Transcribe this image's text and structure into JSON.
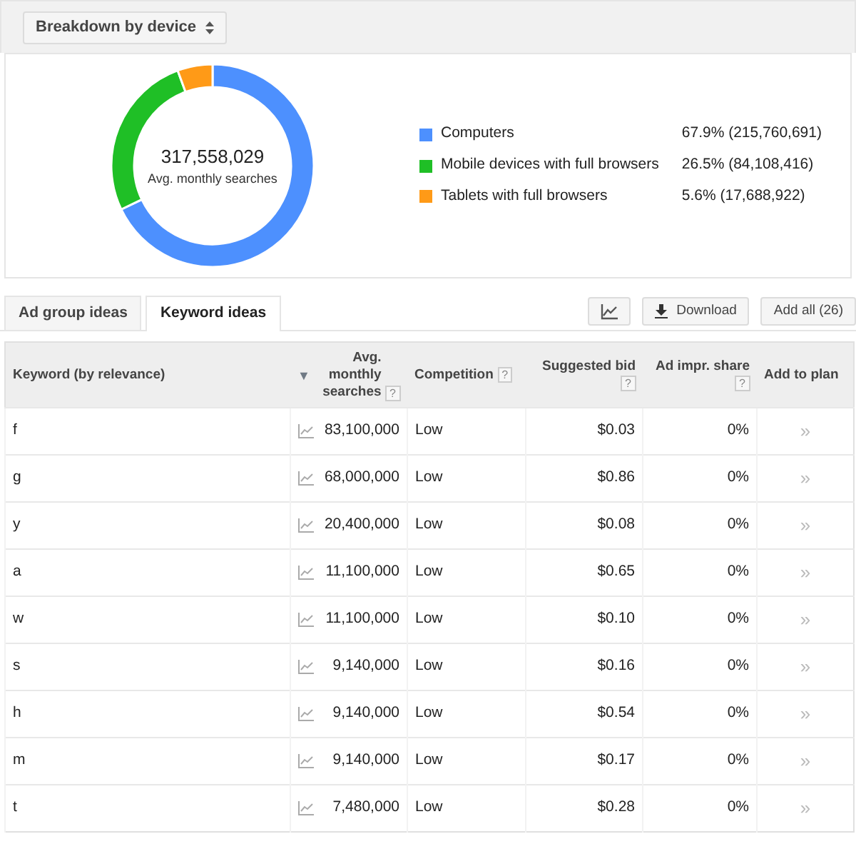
{
  "breakdown_button": {
    "label": "Breakdown by device"
  },
  "summary": {
    "total": "317,558,029",
    "chart_data": {
      "type": "donut",
      "categories": [
        "Computers",
        "Mobile devices with full browsers",
        "Tablets with full browsers"
      ],
      "series": [
        {
          "name": "Avg. monthly searches",
          "values": [
            67.9,
            26.5,
            5.6
          ]
        }
      ]
    },
    "legend": [
      {
        "value": "67.9% (215,760,691)",
        "color": "#4d90fe"
      },
      {
        "value": "26.5% (84,108,416)",
        "color": "#1fbf26"
      },
      {
        "value": "5.6% (17,688,922)",
        "color": "#ff9a17"
      }
    ]
  },
  "tabs": [
    {
      "label": "Ad group ideas",
      "selected": false
    },
    {
      "label": "Keyword ideas",
      "selected": true
    }
  ],
  "toolbar": {
    "download": "Download",
    "add_all": "Add all (26)"
  },
  "table": {
    "columns": [
      {
        "label": "Keyword (by relevance)"
      },
      {
        "label": "Avg. monthly searches",
        "help": true,
        "sorted": true
      },
      {
        "label": "Competition",
        "help": true
      },
      {
        "label": "Suggested bid",
        "help": true
      },
      {
        "label": "Ad impr. share",
        "help": true
      },
      {
        "label": "Add to plan"
      }
    ],
    "help_mark": "?",
    "sort_mark": "▼",
    "add_mark": "»",
    "rows": [
      {
        "keyword": "f",
        "searches": "83,100,000",
        "competition": "Low",
        "bid": "$0.03",
        "share": "0%"
      },
      {
        "keyword": "g",
        "searches": "68,000,000",
        "competition": "Low",
        "bid": "$0.86",
        "share": "0%"
      },
      {
        "keyword": "y",
        "searches": "20,400,000",
        "competition": "Low",
        "bid": "$0.08",
        "share": "0%"
      },
      {
        "keyword": "a",
        "searches": "11,100,000",
        "competition": "Low",
        "bid": "$0.65",
        "share": "0%"
      },
      {
        "keyword": "w",
        "searches": "11,100,000",
        "competition": "Low",
        "bid": "$0.10",
        "share": "0%"
      },
      {
        "keyword": "s",
        "searches": "9,140,000",
        "competition": "Low",
        "bid": "$0.16",
        "share": "0%"
      },
      {
        "keyword": "h",
        "searches": "9,140,000",
        "competition": "Low",
        "bid": "$0.54",
        "share": "0%"
      },
      {
        "keyword": "m",
        "searches": "9,140,000",
        "competition": "Low",
        "bid": "$0.17",
        "share": "0%"
      },
      {
        "keyword": "t",
        "searches": "7,480,000",
        "competition": "Low",
        "bid": "$0.28",
        "share": "0%"
      }
    ]
  }
}
